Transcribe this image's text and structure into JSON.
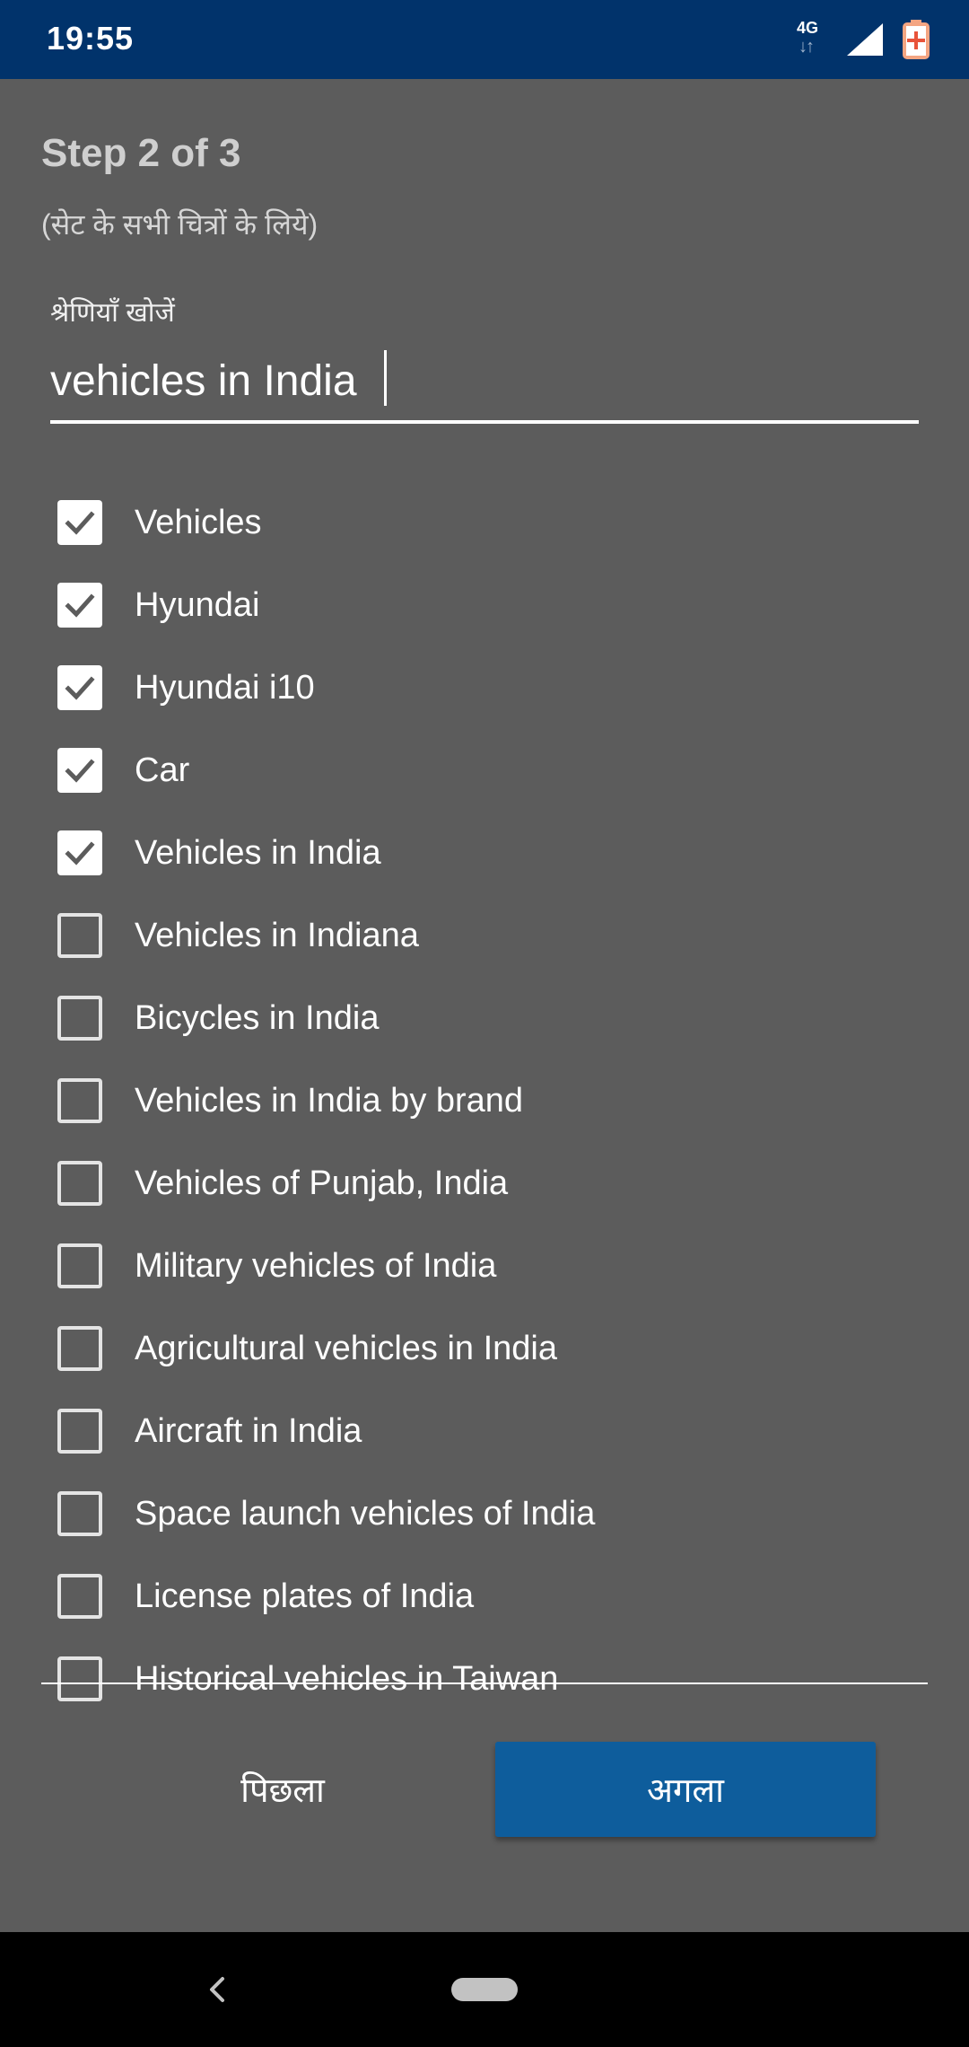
{
  "status_bar": {
    "time": "19:55",
    "network_label": "4G",
    "network_arrows": "↓↑",
    "icons": [
      "network-4g-icon",
      "signal-icon",
      "battery-saver-icon"
    ],
    "background_color": "#01336b"
  },
  "dialog": {
    "step_title": "Step 2 of 3",
    "subtitle": "(सेट के सभी चित्रों के लिये)",
    "search": {
      "label": "श्रेणियाँ खोजें",
      "value": "vehicles in India"
    },
    "categories": [
      {
        "label": "Vehicles",
        "checked": true
      },
      {
        "label": "Hyundai",
        "checked": true
      },
      {
        "label": "Hyundai i10",
        "checked": true
      },
      {
        "label": "Car",
        "checked": true
      },
      {
        "label": "Vehicles in India",
        "checked": true
      },
      {
        "label": "Vehicles in Indiana",
        "checked": false
      },
      {
        "label": "Bicycles in India",
        "checked": false
      },
      {
        "label": "Vehicles in India by brand",
        "checked": false
      },
      {
        "label": "Vehicles of Punjab, India",
        "checked": false
      },
      {
        "label": "Military vehicles of India",
        "checked": false
      },
      {
        "label": "Agricultural vehicles in India",
        "checked": false
      },
      {
        "label": "Aircraft in India",
        "checked": false
      },
      {
        "label": "Space launch vehicles of India",
        "checked": false
      },
      {
        "label": "License plates of India",
        "checked": false
      },
      {
        "label": "Historical vehicles in Taiwan",
        "checked": false
      }
    ],
    "previous_label": "पिछला",
    "next_label": "अगला",
    "colors": {
      "background": "#5c5c5c",
      "primary_button": "#0e5d9c"
    }
  },
  "nav_bar": {
    "icons": [
      "back-icon",
      "home-pill-icon"
    ]
  }
}
